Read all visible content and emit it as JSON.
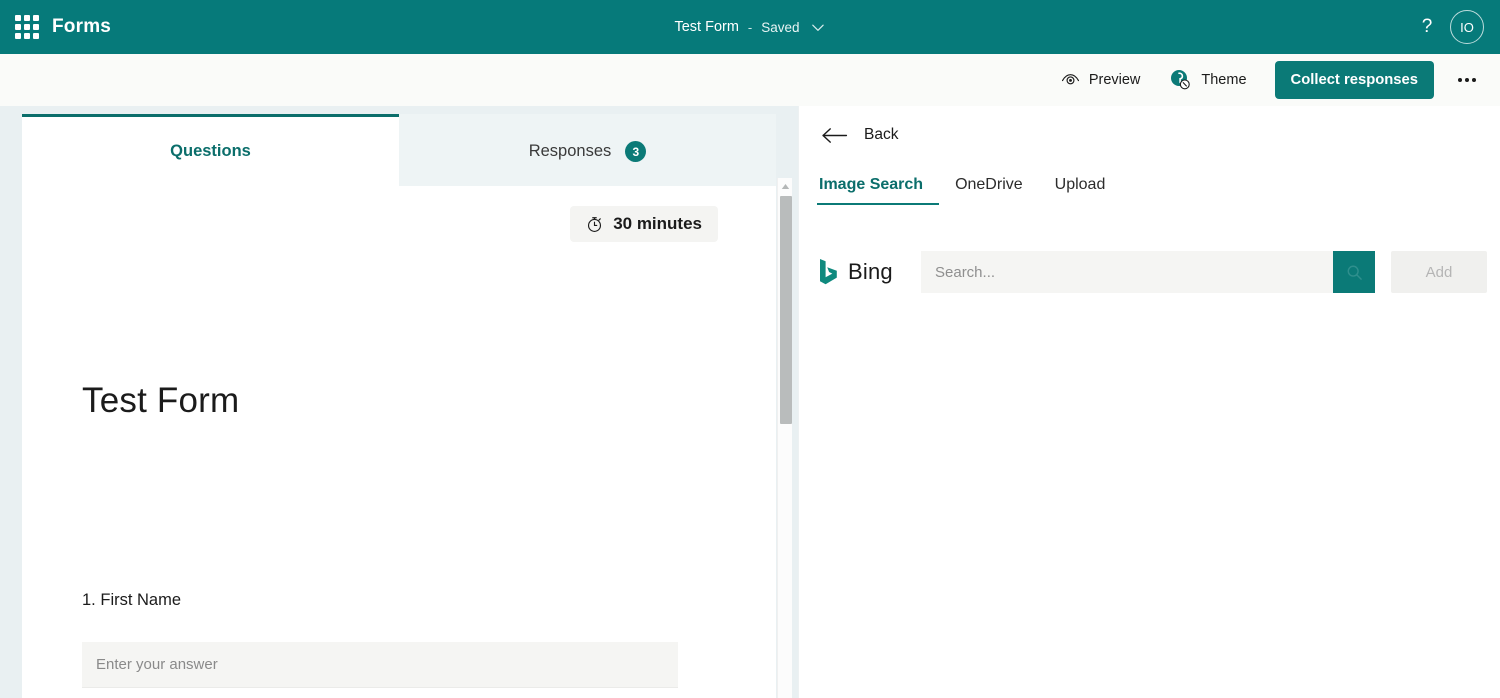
{
  "header": {
    "waffle_icon": "app-launcher-icon",
    "app_name": "Forms",
    "doc_title": "Test Form",
    "separator": "-",
    "save_state": "Saved",
    "chevron_icon": "chevron-down-icon",
    "help_label": "?",
    "avatar_initials": "IO"
  },
  "toolbar": {
    "preview_label": "Preview",
    "preview_icon": "eye-icon",
    "theme_label": "Theme",
    "theme_icon": "palette-icon",
    "collect_label": "Collect responses",
    "more_icon": "ellipsis-icon"
  },
  "editor": {
    "tabs": [
      {
        "label": "Questions",
        "active": true,
        "badge": ""
      },
      {
        "label": "Responses",
        "active": false,
        "badge": "3"
      }
    ],
    "timer": {
      "icon": "stopwatch-icon",
      "label": "30 minutes"
    },
    "form_title": "Test Form",
    "questions": [
      {
        "number": "1.",
        "label": "First Name",
        "answer_placeholder": "Enter your answer",
        "answer_value": ""
      }
    ]
  },
  "panel": {
    "back_icon": "arrow-left-icon",
    "back_label": "Back",
    "tabs": [
      {
        "label": "Image Search",
        "active": true
      },
      {
        "label": "OneDrive",
        "active": false
      },
      {
        "label": "Upload",
        "active": false
      }
    ],
    "search": {
      "provider_icon": "bing-logo-icon",
      "provider_name": "Bing",
      "placeholder": "Search...",
      "value": "",
      "go_icon": "search-icon",
      "add_label": "Add"
    }
  },
  "colors": {
    "brand_teal": "#067a7a",
    "accent_teal": "#0b7a77",
    "active_tab_text": "#0b6e6b",
    "pane_background": "#e9f0f2",
    "toolbar_background": "#fafbf9",
    "field_background": "#f5f5f3"
  }
}
